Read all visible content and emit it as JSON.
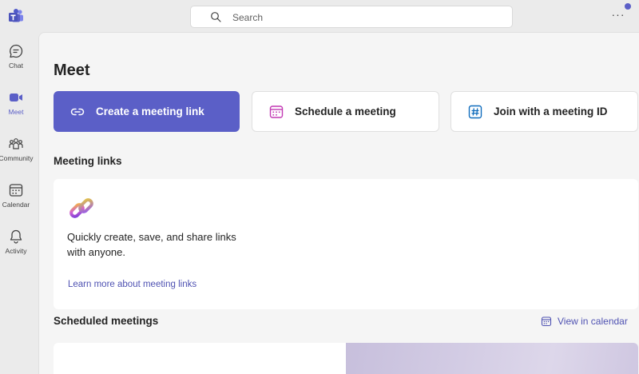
{
  "app": {
    "logo_icon": "teams-logo-icon",
    "accent_color": "#5b5fc7"
  },
  "search": {
    "placeholder": "Search",
    "icon": "search-icon"
  },
  "topbar": {
    "more_label": "···",
    "presence_color": "#5b5fc7"
  },
  "sidebar": {
    "items": [
      {
        "label": "Chat",
        "icon": "chat-icon",
        "active": false
      },
      {
        "label": "Meet",
        "icon": "video-camera-icon",
        "active": true
      },
      {
        "label": "Community",
        "icon": "community-icon",
        "active": false
      },
      {
        "label": "Calendar",
        "icon": "calendar-icon",
        "active": false
      },
      {
        "label": "Activity",
        "icon": "bell-icon",
        "active": false
      }
    ]
  },
  "main": {
    "title": "Meet",
    "actions": [
      {
        "label": "Create a meeting link",
        "icon": "link-icon",
        "style": "primary"
      },
      {
        "label": "Schedule a meeting",
        "icon": "calendar-add-icon",
        "style": "secondary"
      },
      {
        "label": "Join with a meeting ID",
        "icon": "hashtag-icon",
        "style": "secondary"
      }
    ],
    "meeting_links": {
      "heading": "Meeting links",
      "description": "Quickly create, save, and share links with anyone.",
      "learn_more": "Learn more about meeting links"
    },
    "scheduled": {
      "heading": "Scheduled meetings",
      "view_calendar": "View in calendar"
    }
  }
}
